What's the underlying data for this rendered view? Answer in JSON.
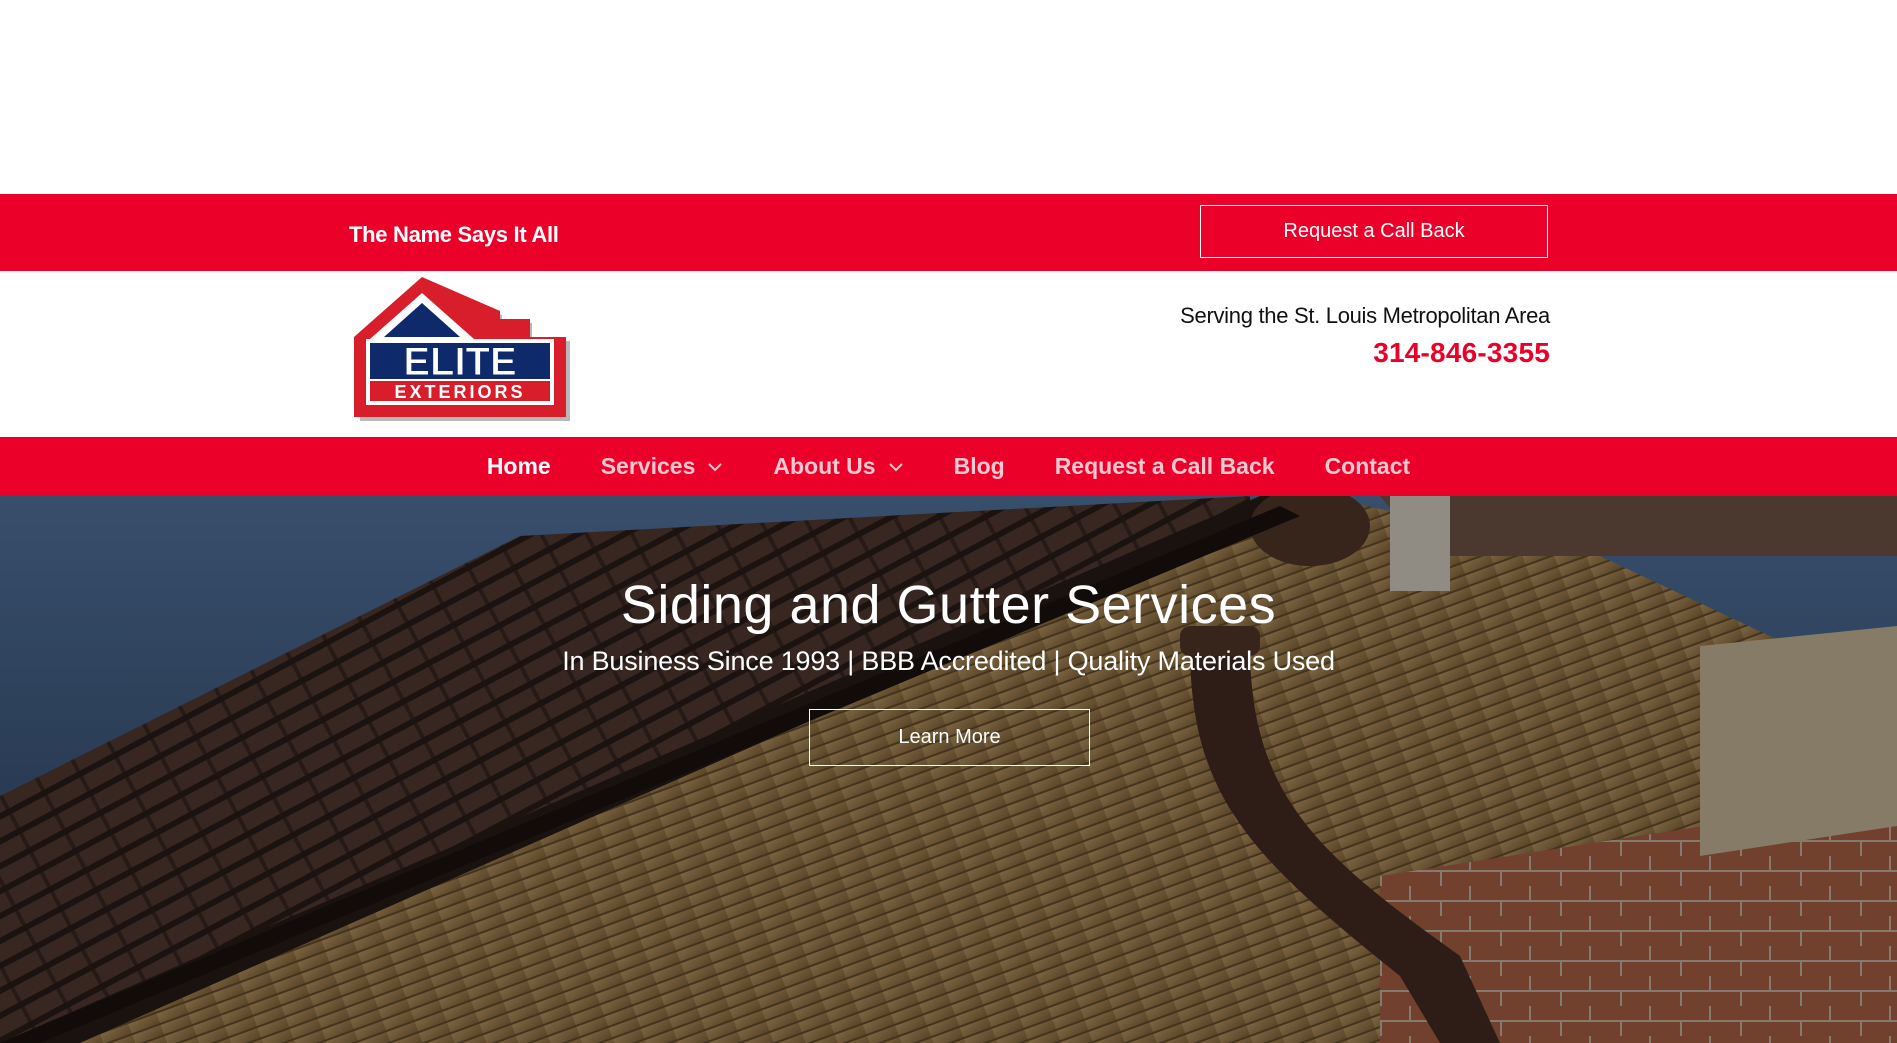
{
  "topbar": {
    "tagline": "The Name Says It All",
    "callback_label": "Request a Call Back"
  },
  "header": {
    "logo_alt": "ELITE EXTERIORS",
    "logo_word_top": "ELITE",
    "logo_word_bottom": "EXTERIORS",
    "serving_text": "Serving the St. Louis Metropolitan Area",
    "phone": "314-846-3355"
  },
  "nav": {
    "items": [
      {
        "label": "Home",
        "active": true
      },
      {
        "label": "Services",
        "dropdown": true
      },
      {
        "label": "About Us",
        "dropdown": true
      },
      {
        "label": "Blog"
      },
      {
        "label": "Request a Call Back"
      },
      {
        "label": "Contact"
      }
    ]
  },
  "hero": {
    "title": "Siding and Gutter Services",
    "subtitle": "In Business Since 1993 | BBB Accredited | Quality Materials Used",
    "button_label": "Learn More"
  },
  "colors": {
    "brand_red": "#eb0029",
    "logo_blue": "#0e2a6b",
    "white": "#ffffff"
  }
}
